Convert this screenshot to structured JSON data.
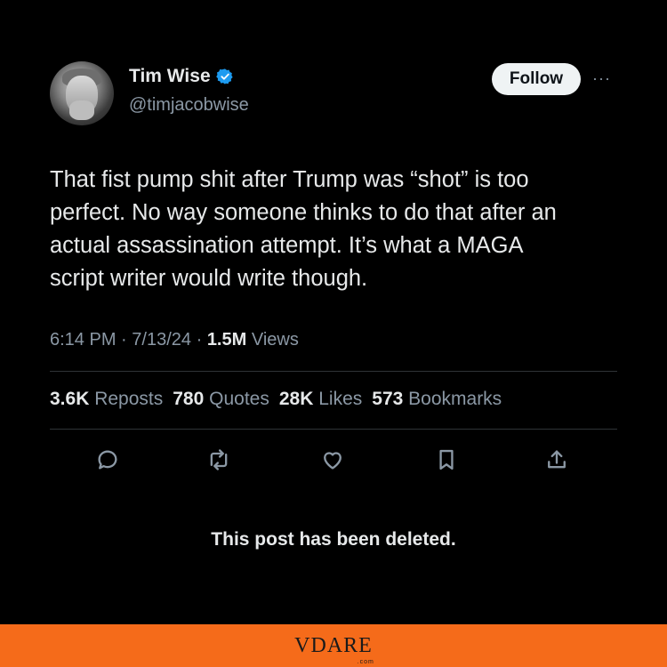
{
  "tweet": {
    "display_name": "Tim Wise",
    "handle": "@timjacobwise",
    "follow_label": "Follow",
    "more_label": "···",
    "text_lines": [
      "That fist pump shit after Trump was “shot” is too",
      "perfect. No way someone thinks to do that after an",
      "actual assassination attempt. It’s what a MAGA",
      "script writer would write though."
    ],
    "time": "6:14 PM",
    "date": "7/13/24",
    "views_count": "1.5M",
    "views_label": "Views",
    "separator": "·",
    "stats": [
      {
        "num": "3.6K",
        "label": "Reposts"
      },
      {
        "num": "780",
        "label": "Quotes"
      },
      {
        "num": "28K",
        "label": "Likes"
      },
      {
        "num": "573",
        "label": "Bookmarks"
      }
    ],
    "actions": [
      "reply-icon",
      "repost-icon",
      "like-icon",
      "bookmark-icon",
      "share-icon"
    ],
    "verified_color": "#1d9bf0"
  },
  "overlay": {
    "deleted_notice": "This post has been deleted."
  },
  "banner": {
    "logo_text": "VDARE",
    "logo_suffix": ".com",
    "color": "#f56b1a"
  }
}
